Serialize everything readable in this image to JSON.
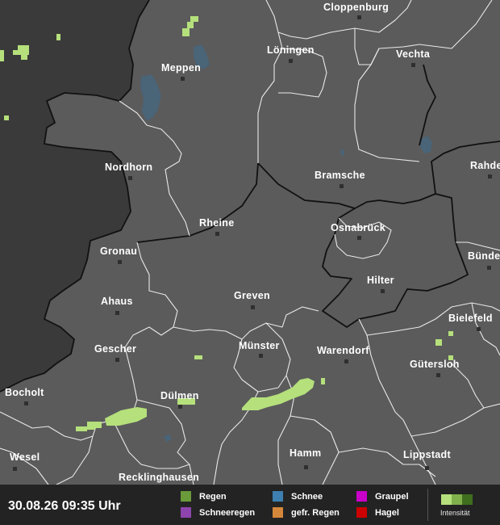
{
  "map": {
    "cities": [
      {
        "name": "Cloppenburg"
      },
      {
        "name": "Löningen"
      },
      {
        "name": "Vechta"
      },
      {
        "name": "Meppen"
      },
      {
        "name": "Nordhorn"
      },
      {
        "name": "Bramsche"
      },
      {
        "name": "Rahde"
      },
      {
        "name": "Rheine"
      },
      {
        "name": "Osnabrück"
      },
      {
        "name": "Gronau"
      },
      {
        "name": "Bünde"
      },
      {
        "name": "Hilter"
      },
      {
        "name": "Ahaus"
      },
      {
        "name": "Greven"
      },
      {
        "name": "Bielefeld"
      },
      {
        "name": "Gescher"
      },
      {
        "name": "Münster"
      },
      {
        "name": "Warendorf"
      },
      {
        "name": "Gütersloh"
      },
      {
        "name": "Bocholt"
      },
      {
        "name": "Dülmen"
      },
      {
        "name": "Wesel"
      },
      {
        "name": "Hamm"
      },
      {
        "name": "Lippstadt"
      },
      {
        "name": "Recklinghausen"
      }
    ],
    "colors": {
      "land": "#5b5b5b",
      "outside_area": "#3a3a3a",
      "water": "#4a6478",
      "rain_light": "#b5e07c"
    }
  },
  "legend": {
    "timestamp": "30.08.26 09:35 Uhr",
    "items": [
      {
        "label": "Regen",
        "color": "#6a9a3a"
      },
      {
        "label": "Schneeregen",
        "color": "#8e44ad"
      },
      {
        "label": "Schnee",
        "color": "#3d7fb0"
      },
      {
        "label": "gefr. Regen",
        "color": "#d4873a"
      },
      {
        "label": "Graupel",
        "color": "#c800c8"
      },
      {
        "label": "Hagel",
        "color": "#cc0000"
      }
    ],
    "intensity_label": "Intensität",
    "intensity_colors": [
      "#b5e07c",
      "#7fb04c",
      "#3f6e1e"
    ]
  }
}
